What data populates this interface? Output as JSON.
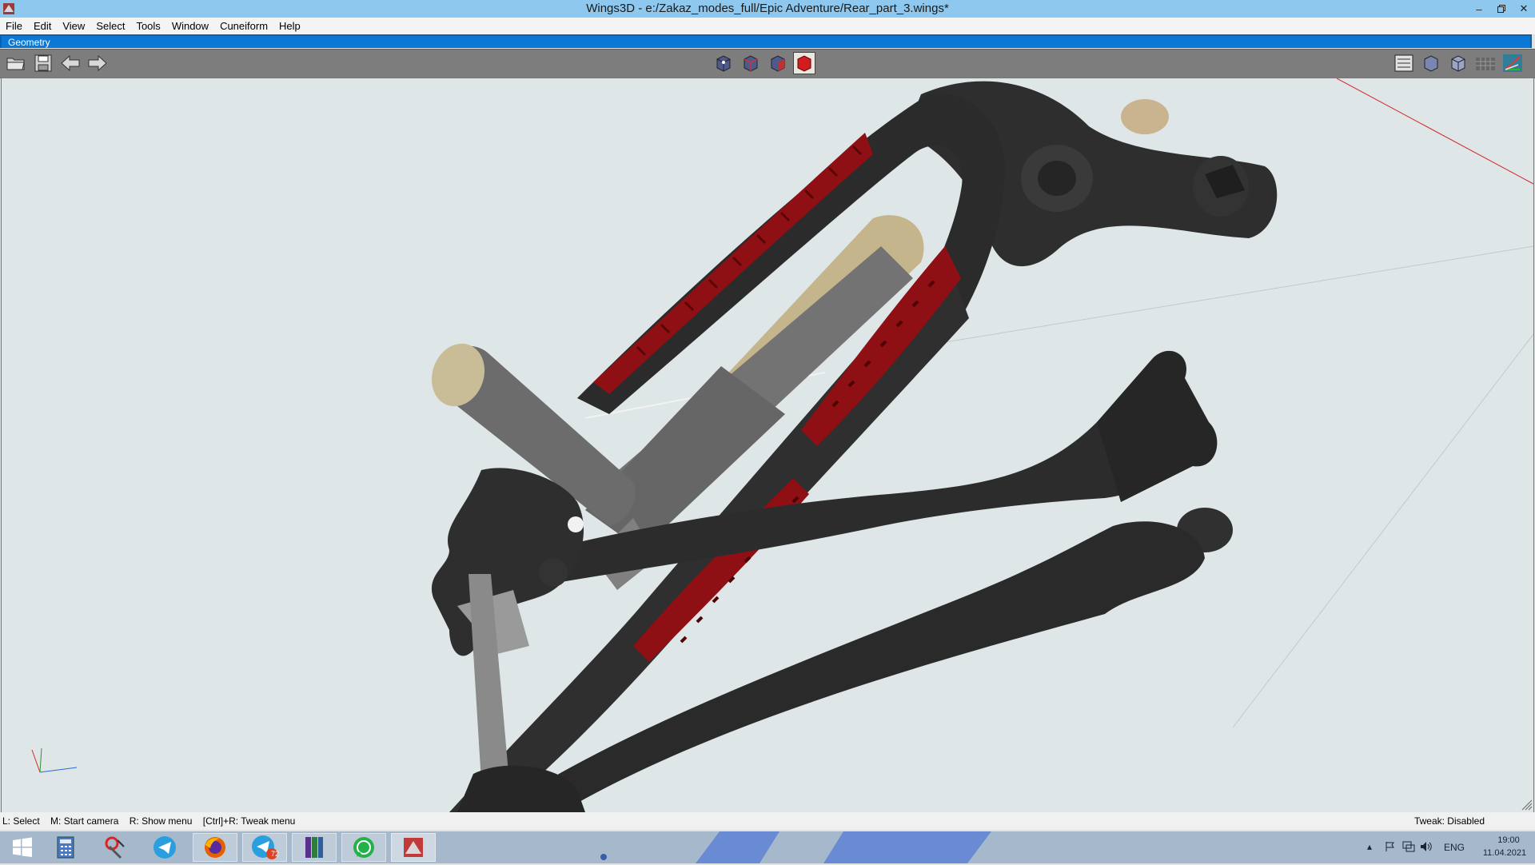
{
  "window": {
    "title": "Wings3D - e:/Zakaz_modes_full/Epic Adventure/Rear_part_3.wings*",
    "app_icon": "wings3d-icon",
    "controls": [
      "minimize-icon",
      "restore-icon",
      "close-icon"
    ]
  },
  "menubar": {
    "items": [
      "File",
      "Edit",
      "View",
      "Select",
      "Tools",
      "Window",
      "Cuneiform",
      "Help"
    ]
  },
  "geometry_bar": {
    "label": "Geometry"
  },
  "toolbar": {
    "left_buttons": [
      "open-folder-icon",
      "save-disk-icon",
      "undo-arrow-icon",
      "redo-arrow-icon"
    ],
    "select_mode_buttons": [
      "vertex-select-icon",
      "edge-select-icon",
      "face-select-icon",
      "body-select-icon"
    ],
    "active_select_mode": "body-select-icon",
    "right_buttons": [
      "outliner-icon",
      "smooth-shading-icon",
      "flat-shading-icon",
      "ground-grid-icon",
      "axes-icon"
    ]
  },
  "statusbar": {
    "hints": [
      "L: Select",
      "M: Start camera",
      "R: Show menu",
      "[Ctrl]+R: Tweak menu"
    ],
    "tweak": "Tweak: Disabled"
  },
  "taskbar": {
    "apps": [
      "windows-start-icon",
      "calculator-icon",
      "paint-tool-icon",
      "telegram-icon",
      "firefox-icon",
      "telegram-badge-icon",
      "winrar-icon",
      "whatsapp-icon",
      "wings3d-icon"
    ],
    "telegram_badge": "72",
    "tray": {
      "language": "ENG",
      "time": "19:00",
      "date": "11.04.2021"
    }
  },
  "colors": {
    "titlebar": "#8fc8ee",
    "geometry_bar": "#0a78d4",
    "toolbar": "#7d7d7d",
    "viewport": "#dfe6e7",
    "frame_body": "#2e2e2e",
    "red_texture": "#8e0f14",
    "shock_grey": "#6d6d6d",
    "taskbar": "#a6b9cc"
  }
}
